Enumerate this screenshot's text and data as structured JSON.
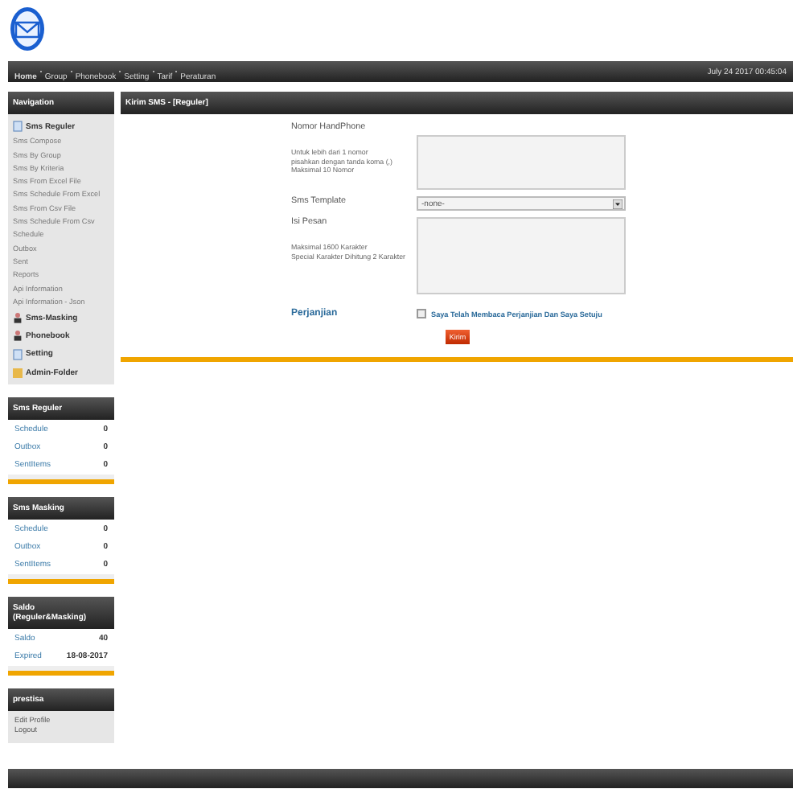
{
  "topbar": {
    "menu": [
      {
        "label": "Home",
        "selected": true
      },
      {
        "label": "Group",
        "selected": false
      },
      {
        "label": "Phonebook",
        "selected": false
      },
      {
        "label": "Setting",
        "selected": false
      },
      {
        "label": "Tarif",
        "selected": false
      },
      {
        "label": "Peraturan",
        "selected": false
      }
    ],
    "datetime": "July 24 2017 00:45:04"
  },
  "navigation": {
    "title": "Navigation",
    "items": [
      {
        "kind": "page",
        "label": "Sms Reguler"
      },
      {
        "kind": "link",
        "label": "Sms Compose"
      },
      {
        "kind": "link",
        "label": "Sms By Group"
      },
      {
        "kind": "link",
        "label": "Sms By Kriteria"
      },
      {
        "kind": "link",
        "label": "Sms From Excel File"
      },
      {
        "kind": "link",
        "label": "Sms Schedule From Excel"
      },
      {
        "kind": "link",
        "label": "Sms From Csv File"
      },
      {
        "kind": "link",
        "label": "Sms Schedule From Csv"
      },
      {
        "kind": "link",
        "label": "Schedule"
      },
      {
        "kind": "link",
        "label": "Outbox"
      },
      {
        "kind": "link",
        "label": "Sent"
      },
      {
        "kind": "link",
        "label": "Reports"
      },
      {
        "kind": "link",
        "label": "Api Information"
      },
      {
        "kind": "link",
        "label": "Api Information - Json"
      },
      {
        "kind": "person",
        "label": "Sms-Masking"
      },
      {
        "kind": "person",
        "label": "Phonebook"
      },
      {
        "kind": "page",
        "label": "Setting"
      },
      {
        "kind": "folder",
        "label": "Admin-Folder"
      }
    ]
  },
  "stat_panels": [
    {
      "title": "Sms Reguler",
      "rows": [
        {
          "label": "Schedule",
          "value": "0"
        },
        {
          "label": "Outbox",
          "value": "0"
        },
        {
          "label": "SentItems",
          "value": "0"
        }
      ]
    },
    {
      "title": "Sms Masking",
      "rows": [
        {
          "label": "Schedule",
          "value": "0"
        },
        {
          "label": "Outbox",
          "value": "0"
        },
        {
          "label": "SentItems",
          "value": "0"
        }
      ]
    },
    {
      "title": "Saldo (Reguler&Masking)",
      "rows": [
        {
          "label": "Saldo",
          "value": "40"
        },
        {
          "label": "Expired",
          "value": "18-08-2017"
        }
      ]
    }
  ],
  "user_panel": {
    "title": "prestisa",
    "links": [
      "Edit Profile",
      "Logout"
    ]
  },
  "main": {
    "title": "Kirim SMS - [Reguler]",
    "phone": {
      "label": "Nomor HandPhone",
      "hint": [
        "Untuk lebih dari 1 nomor",
        "pisahkan dengan tanda koma (,)",
        "Maksimal 10 Nomor"
      ]
    },
    "template": {
      "label": "Sms Template",
      "value": "-none-"
    },
    "message": {
      "label": "Isi Pesan",
      "hint": [
        "Maksimal 1600 Karakter",
        "Special Karakter Dihitung 2 Karakter"
      ]
    },
    "agreement": {
      "label": "Perjanjian",
      "checkbox": "Saya Telah Membaca Perjanjian Dan Saya Setuju",
      "checked": false
    },
    "submit": "Kirim"
  }
}
